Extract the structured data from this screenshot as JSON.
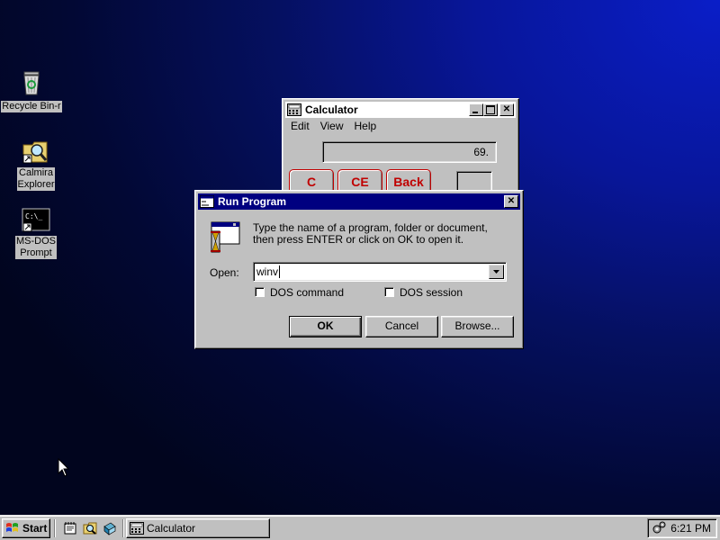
{
  "desktop": {
    "icons": [
      {
        "label": "Recycle Bin-r",
        "icon": "recycle-bin-icon"
      },
      {
        "label": "Calmira Explorer",
        "label_line1": "Calmira",
        "label_line2": "Explorer",
        "icon": "explorer-icon"
      },
      {
        "label": "MS-DOS Prompt",
        "label_line1": "MS-DOS",
        "label_line2": "Prompt",
        "icon": "dos-prompt-icon"
      }
    ]
  },
  "calculator": {
    "title": "Calculator",
    "menu": [
      "Edit",
      "View",
      "Help"
    ],
    "display": "69.",
    "buttons": [
      "C",
      "CE",
      "Back"
    ],
    "state": "inactive"
  },
  "run_dialog": {
    "title": "Run Program",
    "message_line1": "Type the name of a program, folder or document,",
    "message_line2": "then press ENTER or click on OK to open it.",
    "open_label": "Open:",
    "open_value": "winv",
    "dos_command_label": "DOS command",
    "dos_command_checked": false,
    "dos_session_label": "DOS session",
    "dos_session_checked": false,
    "ok_label": "OK",
    "cancel_label": "Cancel",
    "browse_label": "Browse...",
    "close_glyph": "✕",
    "state": "active"
  },
  "taskbar": {
    "start_label": "Start",
    "quick_launch": [
      "notepad-icon",
      "search-icon",
      "help-icon"
    ],
    "tasks": [
      {
        "label": "Calculator",
        "icon": "calculator-icon"
      }
    ],
    "clock": "6:21 PM",
    "tray_icon": "cogs-icon"
  },
  "colors": {
    "title_active": "#000080",
    "face": "#c0c0c0",
    "calc_button_text": "#c00000"
  }
}
